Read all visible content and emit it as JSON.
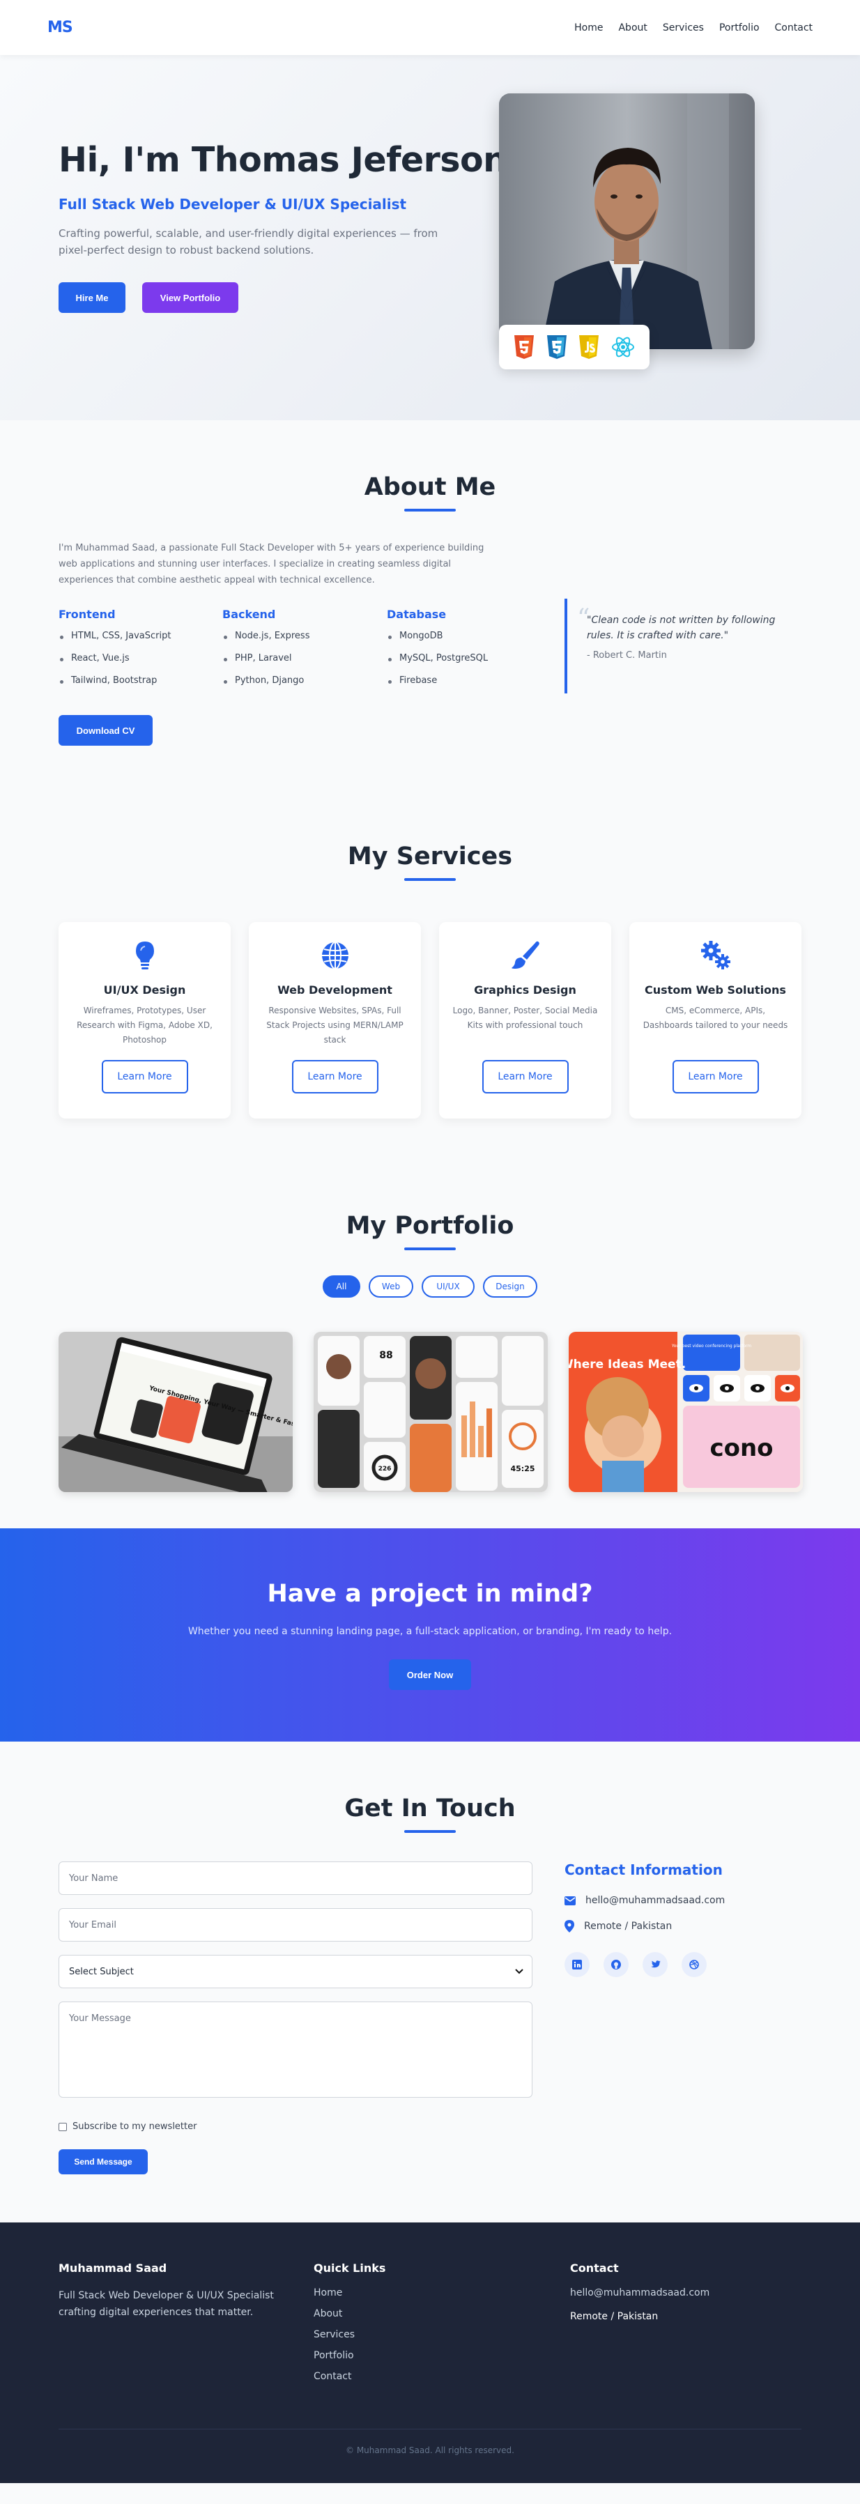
{
  "nav": {
    "logo": "MS",
    "items": [
      "Home",
      "About",
      "Services",
      "Portfolio",
      "Contact"
    ]
  },
  "hero": {
    "title": "Hi, I'm Thomas Jeferson",
    "subtitle": "Full Stack Web Developer & UI/UX Specialist",
    "description": "Crafting powerful, scalable, and user-friendly digital experiences — from pixel-perfect design to robust backend solutions.",
    "hire_label": "Hire Me",
    "portfolio_label": "View Portfolio",
    "tech_icons": [
      "html5-icon",
      "css3-icon",
      "javascript-icon",
      "react-icon"
    ]
  },
  "about": {
    "title": "About Me",
    "intro": "I'm Muhammad Saad, a passionate Full Stack Developer with 5+ years of experience building web applications and stunning user interfaces. I specialize in creating seamless digital experiences that combine aesthetic appeal with technical excellence.",
    "skills": [
      {
        "heading": "Frontend",
        "items": [
          "HTML, CSS, JavaScript",
          "React, Vue.js",
          "Tailwind, Bootstrap"
        ]
      },
      {
        "heading": "Backend",
        "items": [
          "Node.js, Express",
          "PHP, Laravel",
          "Python, Django"
        ]
      },
      {
        "heading": "Database",
        "items": [
          "MongoDB",
          "MySQL, PostgreSQL",
          "Firebase"
        ]
      }
    ],
    "quote": "\"Clean code is not written by following rules. It is crafted with care.\"",
    "quote_author": "- Robert C. Martin",
    "cv_label": "Download CV"
  },
  "services": {
    "title": "My Services",
    "items": [
      {
        "icon": "lightbulb-icon",
        "title": "UI/UX Design",
        "desc": "Wireframes, Prototypes, User Research with Figma, Adobe XD, Photoshop",
        "cta": "Learn More"
      },
      {
        "icon": "globe-icon",
        "title": "Web Development",
        "desc": "Responsive Websites, SPAs, Full Stack Projects using MERN/LAMP stack",
        "cta": "Learn More"
      },
      {
        "icon": "paintbrush-icon",
        "title": "Graphics Design",
        "desc": "Logo, Banner, Poster, Social Media Kits with professional touch",
        "cta": "Learn More"
      },
      {
        "icon": "gears-icon",
        "title": "Custom Web Solutions",
        "desc": "CMS, eCommerce, APIs, Dashboards tailored to your needs",
        "cta": "Learn More"
      }
    ]
  },
  "portfolio": {
    "title": "My Portfolio",
    "filters": [
      "All",
      "Web",
      "UI/UX",
      "Design"
    ],
    "active_filter": "All",
    "project_texts": {
      "shop_heading": "Your Shopping, Your Way — Smarter & Faster",
      "fitness_stat_1": "88",
      "fitness_stat_2": "45:25",
      "fitness_stat_3": "226",
      "ideas_heading": "Where Ideas Meet.",
      "ideas_caption": "Your best video conferencing platform",
      "ideas_logo": "cono"
    }
  },
  "cta": {
    "title": "Have a project in mind?",
    "text": "Whether you need a stunning landing page, a full-stack application, or branding, I'm ready to help.",
    "button": "Order Now"
  },
  "contact": {
    "title": "Get In Touch",
    "name_placeholder": "Your Name",
    "email_placeholder": "Your Email",
    "subject_value": "Select Subject",
    "message_placeholder": "Your Message",
    "newsletter_label": "Subscribe to my newsletter",
    "send_label": "Send Message",
    "info_title": "Contact Information",
    "email": "hello@muhammadsaad.com",
    "location": "Remote / Pakistan",
    "socials": [
      "linkedin-icon",
      "github-icon",
      "twitter-icon",
      "dribbble-icon"
    ]
  },
  "footer": {
    "name": "Muhammad Saad",
    "tagline": "Full Stack Web Developer & UI/UX Specialist crafting digital experiences that matter.",
    "links_title": "Quick Links",
    "links": [
      "Home",
      "About",
      "Services",
      "Portfolio",
      "Contact"
    ],
    "contact_title": "Contact",
    "email": "hello@muhammadsaad.com",
    "location": "Remote / Pakistan",
    "copyright": "© Muhammad Saad. All rights reserved."
  },
  "colors": {
    "primary": "#2563eb",
    "accent": "#7c3aed",
    "footer": "#1e2538"
  }
}
